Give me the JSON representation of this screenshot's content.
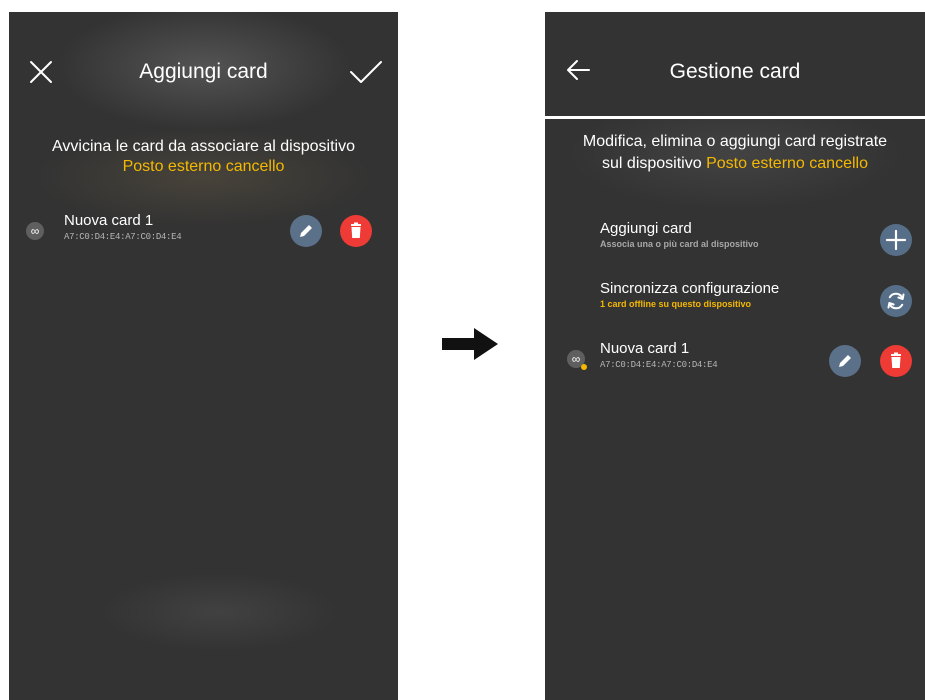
{
  "left_screen": {
    "header": {
      "title": "Aggiungi card"
    },
    "instruction": {
      "line1": "Avvicina le card da associare al dispositivo",
      "device_name": "Posto esterno cancello"
    },
    "cards": [
      {
        "name": "Nuova card 1",
        "mac": "A7:C0:D4:E4:A7:C0:D4:E4"
      }
    ]
  },
  "right_screen": {
    "header": {
      "title": "Gestione card"
    },
    "description": {
      "line1": "Modifica, elimina o aggiungi card registrate",
      "line2_prefix": "sul dispositivo",
      "device_name": "Posto esterno cancello"
    },
    "actions": [
      {
        "title": "Aggiungi card",
        "subtitle": "Associa una o più card al dispositivo"
      },
      {
        "title": "Sincronizza configurazione",
        "subtitle": "1 card offline su questo dispositivo"
      }
    ],
    "cards": [
      {
        "name": "Nuova card 1",
        "mac": "A7:C0:D4:E4:A7:C0:D4:E4",
        "status": "offline"
      }
    ]
  },
  "icons": {
    "close": "close-icon",
    "confirm": "check-icon",
    "back": "arrow-left-icon",
    "card_type": "infinity-icon",
    "edit": "pencil-icon",
    "delete": "trash-icon",
    "add": "plus-icon",
    "sync": "sync-icon",
    "transition": "arrow-right-icon"
  },
  "colors": {
    "accent": "#f5b800",
    "screen_background": "#333333",
    "edit_button": "#5b7089",
    "delete_button": "#ef3b35"
  }
}
